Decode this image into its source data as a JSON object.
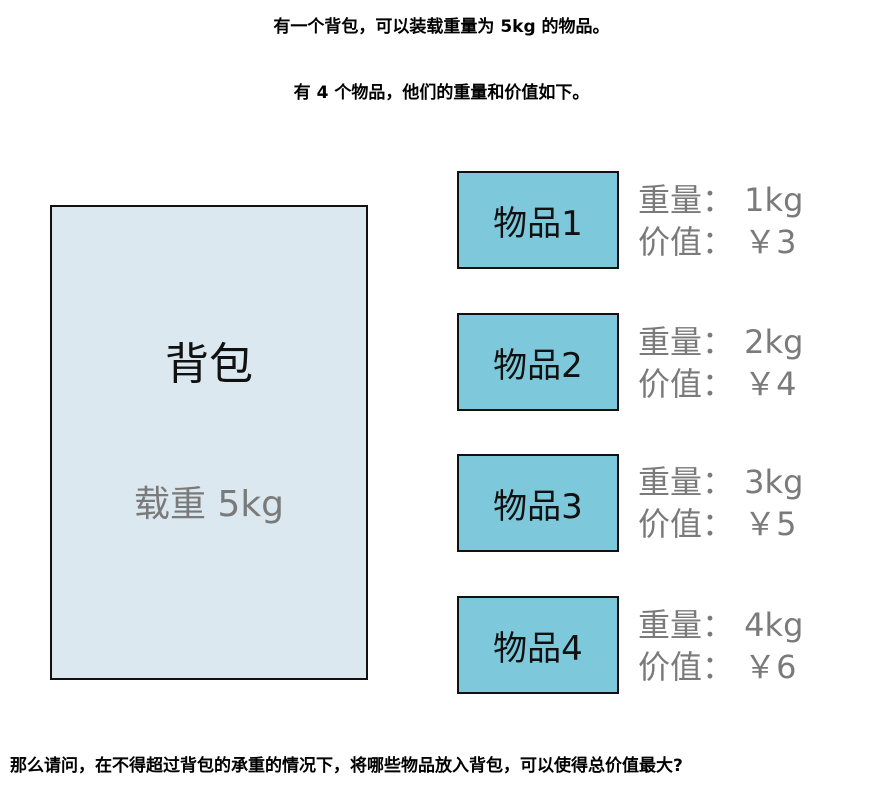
{
  "intro_line1": "有一个背包，可以装载重量为 5kg 的物品。",
  "intro_line2": "有 4 个物品，他们的重量和价值如下。",
  "backpack": {
    "title": "背包",
    "capacity": "载重 5kg"
  },
  "items": [
    {
      "name": "物品1",
      "weight": "重量： 1kg",
      "value": "价值： ￥3"
    },
    {
      "name": "物品2",
      "weight": "重量： 2kg",
      "value": "价值： ￥4"
    },
    {
      "name": "物品3",
      "weight": "重量： 3kg",
      "value": "价值： ￥5"
    },
    {
      "name": "物品4",
      "weight": "重量： 4kg",
      "value": "价值： ￥6"
    }
  ],
  "question": "那么请问，在不得超过背包的承重的情况下，将哪些物品放入背包，可以使得总价值最大?",
  "colors": {
    "backpack_fill": "#dbe8f0",
    "item_fill": "#7ec8dc",
    "info_text": "#7a7a7a"
  }
}
